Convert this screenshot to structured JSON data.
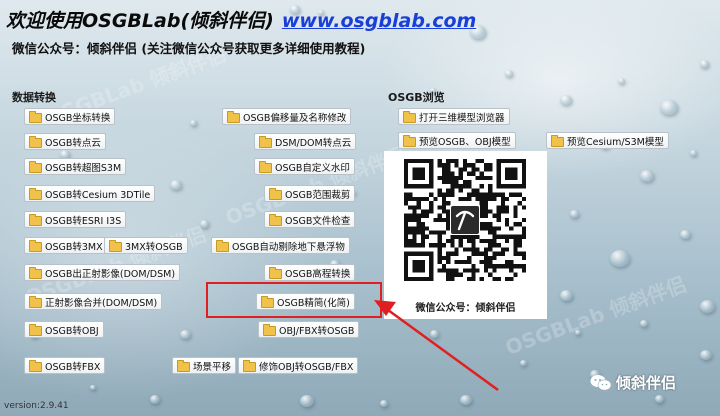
{
  "header": {
    "title": "欢迎使用OSGBLab(倾斜伴侣)",
    "website": "www.osgblab.com",
    "subtitle": "微信公众号：倾斜伴侣 (关注微信公众号获取更多详细使用教程)"
  },
  "sections": {
    "data_convert": "数据转换",
    "osgb_browse": "OSGB浏览"
  },
  "buttons": {
    "coord_convert": "OSGB坐标转换",
    "to_pointcloud": "OSGB转点云",
    "to_s3m": "OSGB转超图S3M",
    "to_cesium": "OSGB转Cesium 3DTile",
    "to_esri": "OSGB转ESRI I3S",
    "to_3mx": "OSGB转3MX",
    "3mx_to_osgb": "3MX转OSGB",
    "dom_dsm": "OSGB出正射影像(DOM/DSM)",
    "ortho_merge": "正射影像合并(DOM/DSM)",
    "to_obj": "OSGB转OBJ",
    "to_fbx": "OSGB转FBX",
    "offset_rename": "OSGB偏移量及名称修改",
    "dsm_to_pc": "DSM/DOM转点云",
    "watermark": "OSGB自定义水印",
    "crop": "OSGB范围裁剪",
    "check": "OSGB文件检查",
    "remove_floating": "OSGB自动剔除地下悬浮物",
    "elevation": "OSGB高程转换",
    "simplify": "OSGB精简(化简)",
    "obj_fbx_to_osgb": "OBJ/FBX转OSGB",
    "scene_pan": "场景平移",
    "fix_obj": "修饰OBJ转OSGB/FBX",
    "open_browser": "打开三维模型浏览器",
    "preview_osgb": "预览OSGB、OBJ模型",
    "preview_cesium": "预览Cesium/S3M模型"
  },
  "qr": {
    "caption": "微信公众号：倾斜伴侣"
  },
  "footer": {
    "version": "version:2.9.41",
    "wechat_name": "倾斜伴侣"
  },
  "watermark_text": "OSGBLab 倾斜伴侣",
  "colors": {
    "title_link": "#1a3fd8",
    "highlight": "#e02020",
    "folder": "#f0c24a"
  }
}
